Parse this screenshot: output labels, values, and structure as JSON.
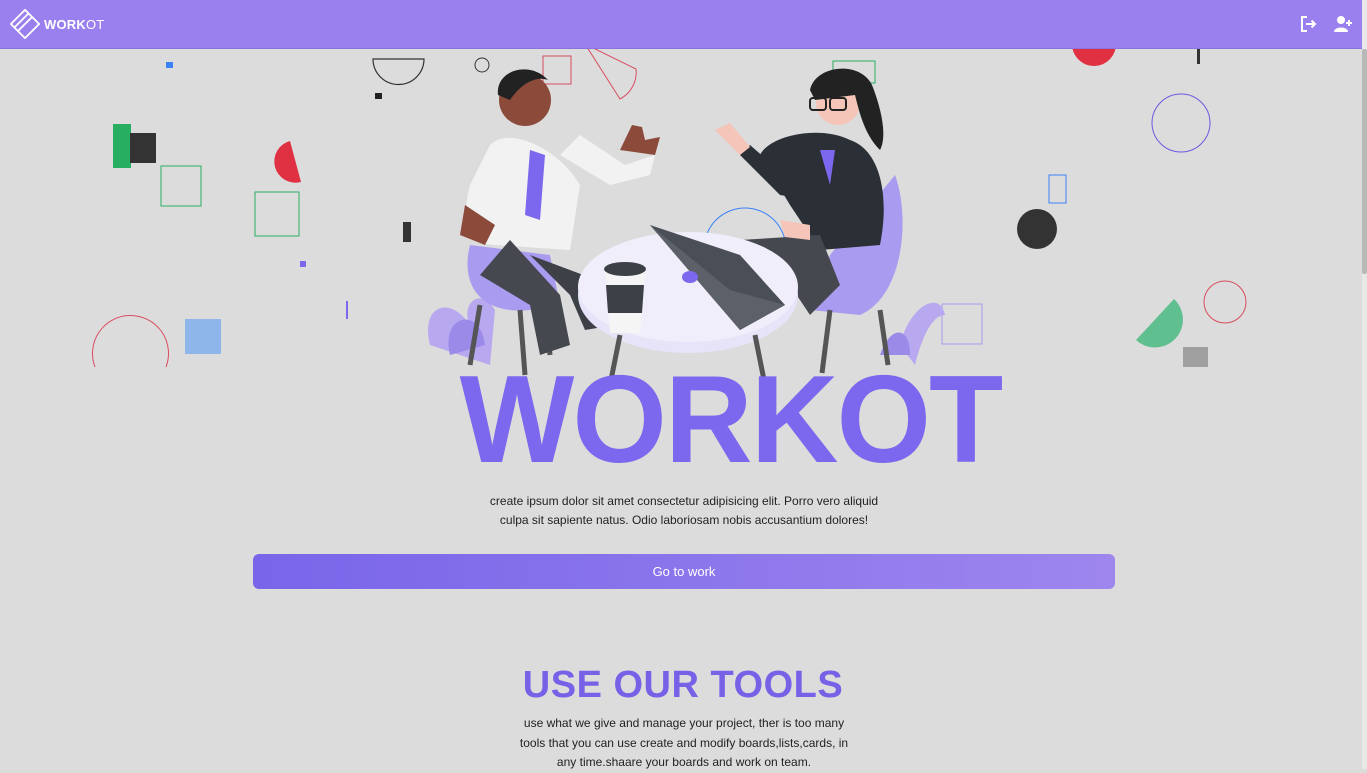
{
  "header": {
    "brand_bold": "WORK",
    "brand_light": "OT",
    "logout_icon": "logout-icon",
    "add_user_icon": "add-user-icon"
  },
  "hero": {
    "headline": "WORKOT",
    "description": "create ipsum dolor sit amet consectetur adipisicing elit. Porro vero aliquid culpa sit sapiente natus. Odio laboriosam nobis accusantium dolores!",
    "cta_label": "Go to work",
    "illustration": "two-people-meeting-at-table"
  },
  "tools": {
    "title": "USE OUR TOOLS",
    "description": "use what we give and manage your project, ther is too many tools that you can use create and modify boards,lists,cards, in any time.shaare your boards and work on team."
  },
  "colors": {
    "accent": "#7b68ee",
    "header_bg": "#9a80ee",
    "page_bg": "#dcdcdc"
  }
}
